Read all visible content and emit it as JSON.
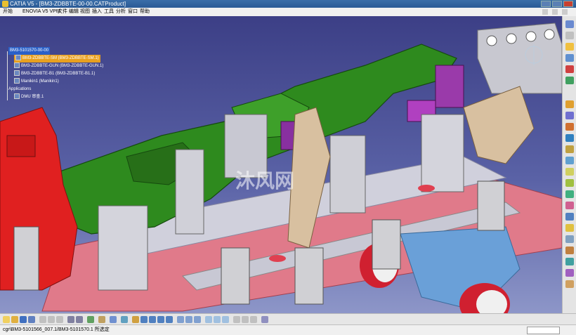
{
  "window": {
    "title": "CATIA V5 - [BM3-ZDBBTE-00-00.CATProduct]"
  },
  "menu": {
    "items": [
      "开始",
      "ENOVIA V5 VPM",
      "文件",
      "编辑",
      "视图",
      "插入",
      "工具",
      "分析",
      "窗口",
      "帮助"
    ]
  },
  "tree": {
    "root": "BM3-5101570-00-00",
    "items": [
      "BM3-ZDBBTE-SM (BM3-ZDBBTE-SM.1)",
      "BM3-ZDBBTE-GUN (BM3-ZDBBTE-GUN.1)",
      "BM3-ZDBBTE-B1 (BM3-ZDBBTE-B1.1)",
      "Manikin1 (Manikin1)",
      "Applications"
    ],
    "sub": "DMU 审查.1"
  },
  "watermark": "沐风网",
  "status": {
    "text": "cgr\\BM3-5101566_007.1/BM3-5101570.1 所选定"
  },
  "colors": {
    "viewport_top": "#3c3f86",
    "viewport_bottom": "#8d96c8",
    "fixture_green": "#2e8a1e",
    "base_red": "#e07a8a",
    "clamp_gray": "#cfcfd6"
  }
}
